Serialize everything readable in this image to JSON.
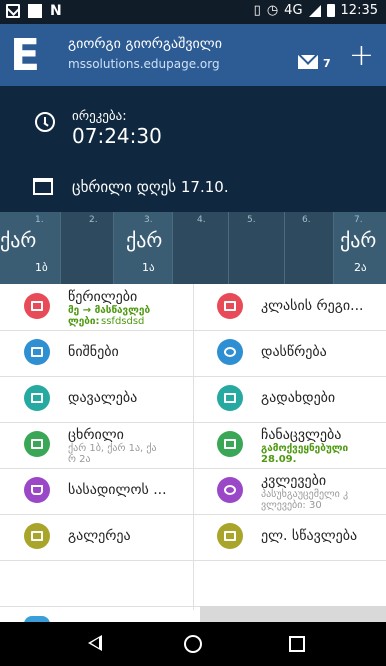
{
  "status_bar": {
    "network": "4G",
    "time": "12:35"
  },
  "header": {
    "logo": "E",
    "user_name": "გიორგი გიორგაშვილი",
    "domain": "mssolutions.edupage.org",
    "message_count": "7",
    "add": "+"
  },
  "info": {
    "time_label": "ირეკება:",
    "time_value": "07:24:30",
    "day_text": "ცხრილი დღეს 17.10."
  },
  "timetable": [
    {
      "num": "1.",
      "subject": "ქარ",
      "class": "1ბ"
    },
    {
      "num": "2.",
      "subject": "",
      "class": ""
    },
    {
      "num": "3.",
      "subject": "ქარ",
      "class": "1ა"
    },
    {
      "num": "4.",
      "subject": "",
      "class": ""
    },
    {
      "num": "5.",
      "subject": "",
      "class": ""
    },
    {
      "num": "6.",
      "subject": "",
      "class": ""
    },
    {
      "num": "7.",
      "subject": "ქარ",
      "class": "2ა"
    }
  ],
  "tiles": {
    "messages": {
      "label": "წერილები",
      "line2": "მე → მასწავლებ",
      "line3": "ლები:",
      "line3b": "ssfdsdsd",
      "color": "#e84b57"
    },
    "class_register": {
      "label": "კლასის რეგი...",
      "color": "#e84b57"
    },
    "grades": {
      "label": "ნიშნები",
      "color": "#2f8fd3"
    },
    "attendance": {
      "label": "დასწრება",
      "color": "#2f8fd3"
    },
    "homework": {
      "label": "დავალება",
      "color": "#25a9a0"
    },
    "payments": {
      "label": "გადახდები",
      "color": "#25a9a0"
    },
    "timetable": {
      "label": "ცხრილი",
      "sub": "ქარ 1ბ, ქარ 1ა, ქა",
      "sub2": "რ 2ა",
      "color": "#3aa757"
    },
    "planning": {
      "label": "ჩანაცვლება",
      "sub": "გამოქვეყნებული",
      "sub2": "28.09.",
      "color": "#3aa757"
    },
    "canteen": {
      "label": "სასადილოს ...",
      "color": "#9a48c8"
    },
    "surveys": {
      "label": "კვლევები",
      "sub": "პასუხგაუცემელი კ",
      "sub2": "ვლევები: 30",
      "color": "#9a48c8"
    },
    "gallery": {
      "label": "გალერეა",
      "color": "#a9a52a"
    },
    "elearning": {
      "label": "ელ. სწავლება",
      "color": "#a9a52a"
    }
  }
}
